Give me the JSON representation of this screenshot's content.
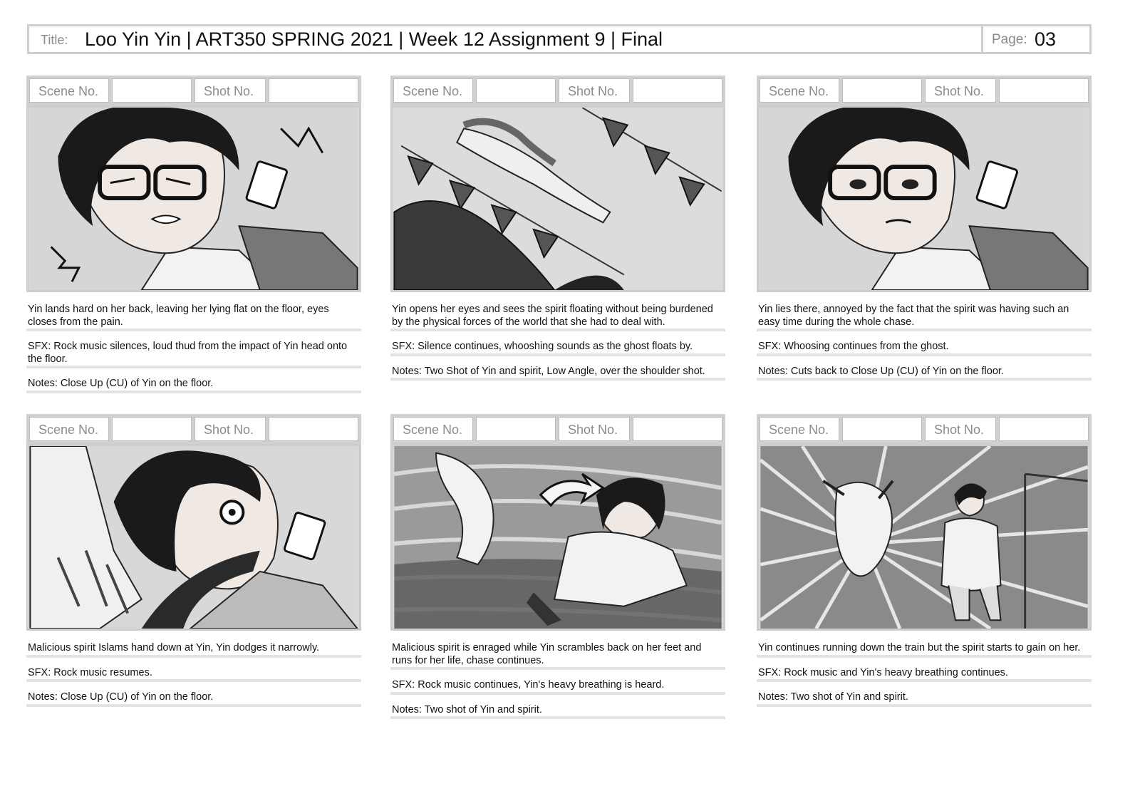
{
  "header": {
    "title_label": "Title:",
    "title": "Loo Yin Yin | ART350 SPRING 2021 | Week 12 Assignment 9  |  Final",
    "page_label": "Page:",
    "page_number": "03"
  },
  "panel_labels": {
    "scene": "Scene No.",
    "shot": "Shot No."
  },
  "panels": [
    {
      "description": "Yin lands hard on her back, leaving her lying flat on the floor, eyes closes from the pain.",
      "sfx": "SFX: Rock music silences, loud thud from the impact of Yin head onto the floor.",
      "notes": "Notes: Close Up (CU) of Yin on the floor."
    },
    {
      "description": "Yin opens her eyes and sees the spirit floating without being burdened by the physical forces of the world that she had to deal with.",
      "sfx": "SFX: Silence continues, whooshing sounds as the ghost floats by.",
      "notes": "Notes: Two Shot of Yin and spirit, Low Angle, over the shoulder shot."
    },
    {
      "description": "Yin lies there, annoyed by the fact that the spirit was having such an easy time during the whole chase.",
      "sfx": "SFX: Whoosing continues from the ghost.",
      "notes": "Notes: Cuts back to Close Up (CU) of Yin on the floor."
    },
    {
      "description": "Malicious spirit Islams hand down at Yin, Yin dodges it narrowly.",
      "sfx": "SFX: Rock music resumes.",
      "notes": "Notes: Close Up (CU) of Yin on the floor."
    },
    {
      "description": "Malicious spirit is enraged while Yin scrambles back on her feet and runs for her life, chase continues.",
      "sfx": "SFX: Rock music continues, Yin's heavy breathing is heard.",
      "notes": "Notes: Two shot of Yin and spirit."
    },
    {
      "description": "Yin continues running down the train but the spirit starts to gain on her.",
      "sfx": "SFX: Rock music and Yin's heavy breathing continues.",
      "notes": "Notes: Two shot of Yin and spirit."
    }
  ]
}
